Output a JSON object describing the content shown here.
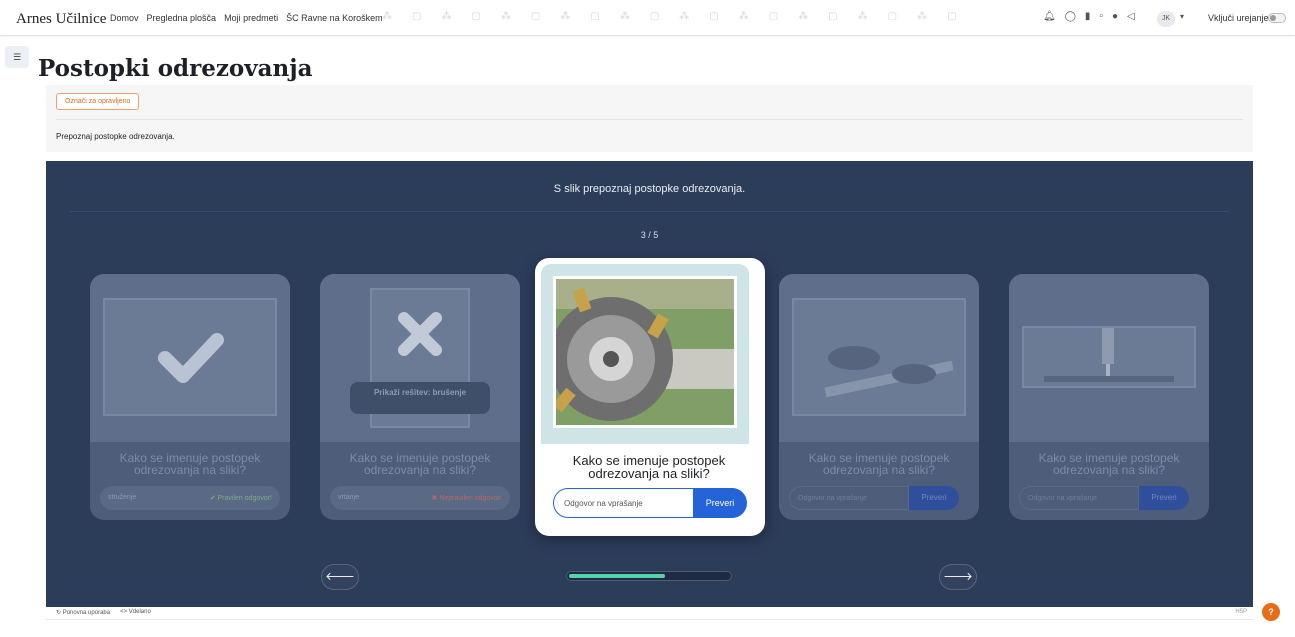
{
  "navbar": {
    "brand": "Arnes Učilnice",
    "links": [
      "Domov",
      "Pregledna plošča",
      "Moji predmeti",
      "ŠC Ravne na Koroškem"
    ],
    "avatar_initials": "JK",
    "edit_mode_label": "Vključi urejanje",
    "icons": [
      "bell-icon",
      "chat-icon",
      "book-icon",
      "square-icon",
      "help-icon",
      "megaphone-icon"
    ]
  },
  "page": {
    "title": "Postopki odrezovanja",
    "mark_done_label": "Označi za opravljeno",
    "intro": "Prepoznaj postopke odrezovanja."
  },
  "h5p": {
    "title": "S slik prepoznaj postopke odrezovanja.",
    "counter": "3 / 5",
    "question": "Kako se imenuje postopek odrezovanja na sliki?",
    "input_placeholder": "Odgovor na vprašanje",
    "check_label": "Preveri",
    "progress_fraction": 0.6,
    "cards": [
      {
        "answer": "struženje",
        "feedback": "✔ Pravilen odgovor!",
        "status": "correct"
      },
      {
        "answer": "vrtanje",
        "feedback": "✖ Nepravilen odgovor!",
        "status": "wrong",
        "solution": "Prikaži rešitev: brušenje"
      },
      {
        "status": "active"
      },
      {
        "status": "pending"
      },
      {
        "status": "pending"
      }
    ],
    "footer": {
      "reuse": "Ponovna uporaba",
      "embed": "Vdelano",
      "brand": "H5P"
    }
  },
  "colors": {
    "accent": "#2563d9",
    "panel": "#2c3d5a",
    "progress": "#58d2a7",
    "complete": "#e0692a"
  }
}
